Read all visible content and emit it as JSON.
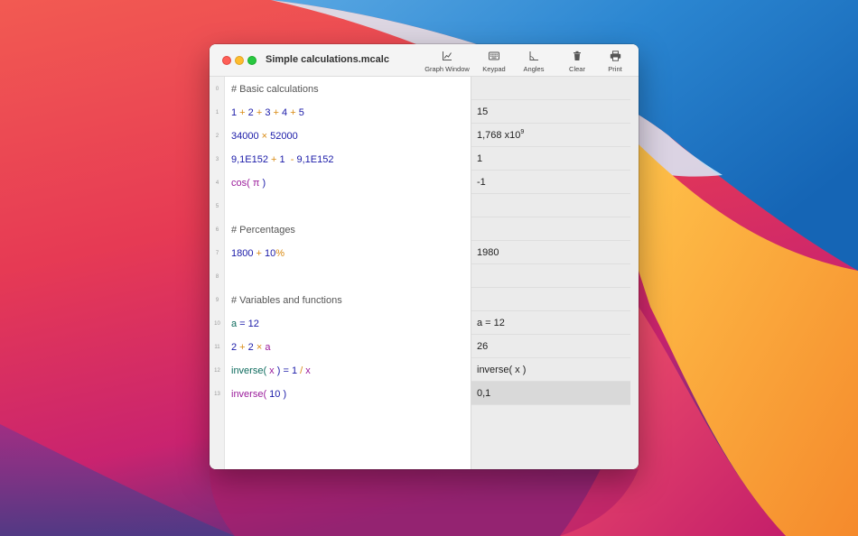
{
  "window": {
    "title": "Simple calculations.mcalc"
  },
  "toolbar": {
    "graph_window": {
      "label": "Graph Window",
      "icon": "graph-window-icon"
    },
    "keypad": {
      "label": "Keypad",
      "icon": "keypad-icon"
    },
    "angles": {
      "label": "Angles",
      "icon": "angles-icon"
    },
    "clear": {
      "label": "Clear",
      "icon": "trash-icon"
    },
    "print": {
      "label": "Print",
      "icon": "printer-icon"
    }
  },
  "colors": {
    "comment": "#555555",
    "number": "#1a1aa8",
    "operator": "#d98a12",
    "function": "#9b1c9b",
    "user_function": "#0e6b5e"
  },
  "lines": [
    {
      "number": "0",
      "tokens": [
        {
          "t": "# Basic calculations",
          "k": "comment"
        }
      ],
      "result": ""
    },
    {
      "number": "1",
      "tokens": [
        {
          "t": "1",
          "k": "num"
        },
        {
          "t": " + ",
          "k": "op"
        },
        {
          "t": "2",
          "k": "num"
        },
        {
          "t": " + ",
          "k": "op"
        },
        {
          "t": "3",
          "k": "num"
        },
        {
          "t": " + ",
          "k": "op"
        },
        {
          "t": "4",
          "k": "num"
        },
        {
          "t": " + ",
          "k": "op"
        },
        {
          "t": "5",
          "k": "num"
        }
      ],
      "result": "15"
    },
    {
      "number": "2",
      "tokens": [
        {
          "t": "34000",
          "k": "num"
        },
        {
          "t": " × ",
          "k": "op"
        },
        {
          "t": "52000",
          "k": "num"
        }
      ],
      "result": "1,768 x10",
      "result_exp": "9"
    },
    {
      "number": "3",
      "tokens": [
        {
          "t": "9,1E152",
          "k": "num"
        },
        {
          "t": " + ",
          "k": "op"
        },
        {
          "t": "1",
          "k": "num"
        },
        {
          "t": "  - ",
          "k": "op"
        },
        {
          "t": "9,1E152",
          "k": "num"
        }
      ],
      "result": "1"
    },
    {
      "number": "4",
      "tokens": [
        {
          "t": "cos(",
          "k": "fn"
        },
        {
          "t": " π ",
          "k": "fn"
        },
        {
          "t": ")",
          "k": "num"
        }
      ],
      "result": "-1"
    },
    {
      "number": "5",
      "tokens": [],
      "result": ""
    },
    {
      "number": "6",
      "tokens": [
        {
          "t": "# Percentages",
          "k": "comment"
        }
      ],
      "result": ""
    },
    {
      "number": "7",
      "tokens": [
        {
          "t": "1800",
          "k": "num"
        },
        {
          "t": " + ",
          "k": "op"
        },
        {
          "t": "10",
          "k": "num"
        },
        {
          "t": "%",
          "k": "pct"
        }
      ],
      "result": "1980"
    },
    {
      "number": "8",
      "tokens": [],
      "result": ""
    },
    {
      "number": "9",
      "tokens": [
        {
          "t": "# Variables and functions",
          "k": "comment"
        }
      ],
      "result": ""
    },
    {
      "number": "10",
      "tokens": [
        {
          "t": "a",
          "k": "ufn"
        },
        {
          "t": " = ",
          "k": "num"
        },
        {
          "t": "12",
          "k": "num"
        }
      ],
      "result": "a = 12"
    },
    {
      "number": "11",
      "tokens": [
        {
          "t": "2",
          "k": "num"
        },
        {
          "t": " + ",
          "k": "op"
        },
        {
          "t": "2",
          "k": "num"
        },
        {
          "t": " × ",
          "k": "op"
        },
        {
          "t": "a",
          "k": "var"
        }
      ],
      "result": "26"
    },
    {
      "number": "12",
      "tokens": [
        {
          "t": "inverse(",
          "k": "ufn"
        },
        {
          "t": " x ",
          "k": "var"
        },
        {
          "t": ") = ",
          "k": "num"
        },
        {
          "t": "1",
          "k": "num"
        },
        {
          "t": " / ",
          "k": "op"
        },
        {
          "t": "x",
          "k": "var"
        }
      ],
      "result": "inverse( x )"
    },
    {
      "number": "13",
      "tokens": [
        {
          "t": "inverse(",
          "k": "fn"
        },
        {
          "t": " 10 ",
          "k": "num"
        },
        {
          "t": ")",
          "k": "num"
        }
      ],
      "result": "0,1",
      "selected": true
    }
  ]
}
